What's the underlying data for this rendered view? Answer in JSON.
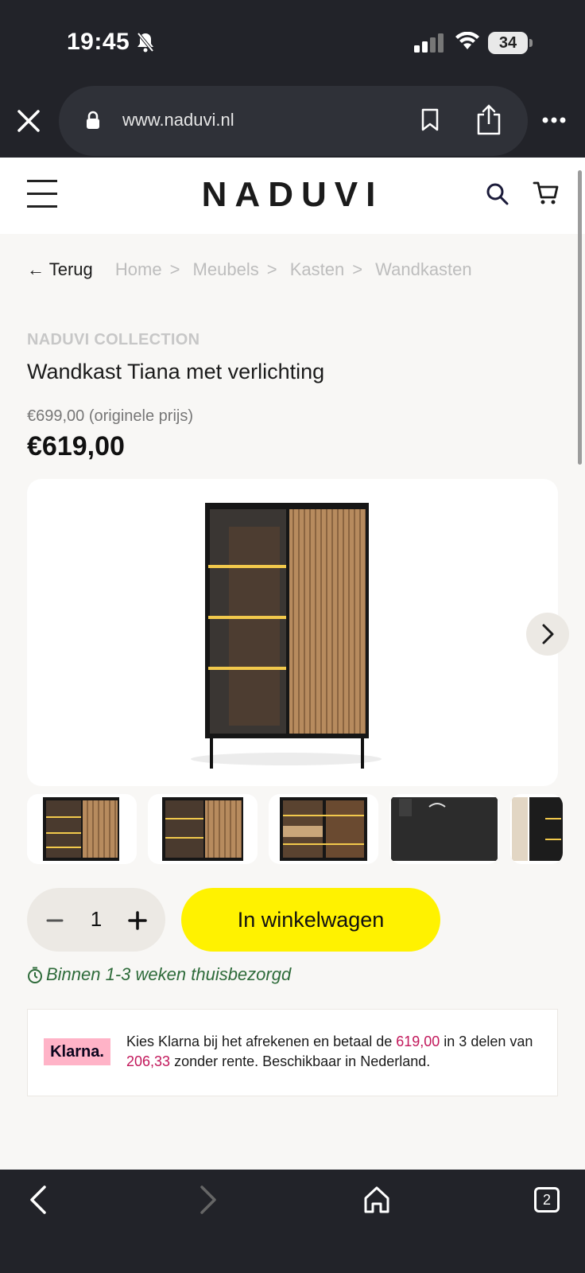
{
  "status": {
    "time": "19:45",
    "battery": "34"
  },
  "browser": {
    "url": "www.naduvi.nl",
    "tab_count": "2"
  },
  "site": {
    "logo": "NADUVI"
  },
  "breadcrumb": {
    "back": "← Terug",
    "items": [
      "Home",
      "Meubels",
      "Kasten",
      "Wandkasten"
    ],
    "separator": ">"
  },
  "product": {
    "brand": "NADUVI COLLECTION",
    "title": "Wandkast Tiana met verlichting",
    "old_price": "€699,00 (originele prijs)",
    "price": "€619,00"
  },
  "cart": {
    "quantity": "1",
    "add_label": "In winkelwagen"
  },
  "delivery": {
    "text": "Binnen 1-3 weken thuisbezorgd"
  },
  "klarna": {
    "logo": "Klarna.",
    "text_1": "Kies Klarna bij het afrekenen en betaal de ",
    "amount_total": "619,00",
    "text_2": " in 3 delen van ",
    "amount_part": "206,33",
    "text_3": " zonder rente. Beschikbaar in Nederland."
  },
  "colors": {
    "accent": "#fff200",
    "delivery": "#2e6b3a",
    "klarna": "#ffb3c7",
    "highlight": "#c2185b"
  },
  "icons": [
    "bell-off-icon",
    "signal-icon",
    "wifi-icon",
    "close-icon",
    "lock-icon",
    "bookmark-icon",
    "share-icon",
    "more-icon",
    "menu-icon",
    "search-icon",
    "cart-icon",
    "chevron-right-icon",
    "minus-icon",
    "plus-icon",
    "clock-icon",
    "back-icon",
    "forward-icon",
    "home-icon",
    "tabs-icon"
  ]
}
